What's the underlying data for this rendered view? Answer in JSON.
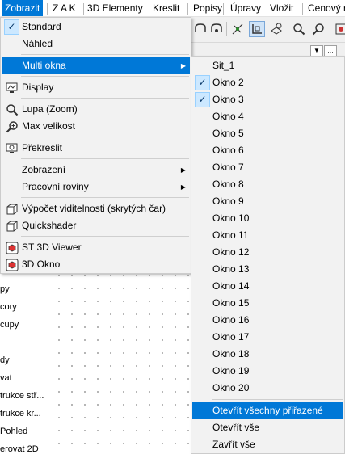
{
  "menubar": {
    "items": [
      "Zobrazit",
      "Z A K",
      "3D Elementy",
      "Kreslit",
      "Popisy",
      "Úpravy",
      "Vložit",
      "Cenový r"
    ]
  },
  "left_panel": {
    "items": [
      "py",
      "cory",
      "cupy",
      "dy",
      "vat",
      "trukce stř...",
      "trukce kr...",
      "Pohled",
      "erovat 2D"
    ]
  },
  "main_menu": {
    "items": [
      {
        "label": "Standard",
        "checked": true
      },
      {
        "label": "Náhled"
      },
      {
        "label": "Multi okna",
        "submenu": true,
        "highlighted": true
      },
      {
        "label": "Display",
        "icon": "display-icon"
      },
      {
        "label": "Lupa (Zoom)",
        "icon": "magnifier-icon"
      },
      {
        "label": "Max velikost",
        "icon": "zoom-extents-icon"
      },
      {
        "label": "Překreslit",
        "icon": "redraw-icon"
      },
      {
        "label": "Zobrazení",
        "submenu": true
      },
      {
        "label": "Pracovní roviny",
        "submenu": true
      },
      {
        "label": "Výpočet viditelnosti (skrytých čar)",
        "icon": "hidden-lines-icon"
      },
      {
        "label": "Quickshader",
        "icon": "cube-icon"
      },
      {
        "label": "ST 3D Viewer",
        "icon": "3d-viewer-icon"
      },
      {
        "label": "3D Okno",
        "icon": "3d-window-icon"
      }
    ]
  },
  "sub_menu": {
    "items": [
      {
        "label": "Sit_1"
      },
      {
        "label": "Okno 2",
        "checked": true
      },
      {
        "label": "Okno 3",
        "checked": true
      },
      {
        "label": "Okno 4"
      },
      {
        "label": "Okno 5"
      },
      {
        "label": "Okno 6"
      },
      {
        "label": "Okno 7"
      },
      {
        "label": "Okno 8"
      },
      {
        "label": "Okno 9"
      },
      {
        "label": "Okno 10"
      },
      {
        "label": "Okno 11"
      },
      {
        "label": "Okno 12"
      },
      {
        "label": "Okno 13"
      },
      {
        "label": "Okno 14"
      },
      {
        "label": "Okno 15"
      },
      {
        "label": "Okno 16"
      },
      {
        "label": "Okno 17"
      },
      {
        "label": "Okno 18"
      },
      {
        "label": "Okno 19"
      },
      {
        "label": "Okno 20"
      },
      {
        "label": "Otevřít všechny přiřazené",
        "highlighted": true
      },
      {
        "label": "Otevřít vše"
      },
      {
        "label": "Zavřít vše"
      }
    ]
  },
  "colors": {
    "highlight": "#0078d7",
    "menu_bg": "#f2f2f2",
    "check_bg": "#cce8ff"
  }
}
